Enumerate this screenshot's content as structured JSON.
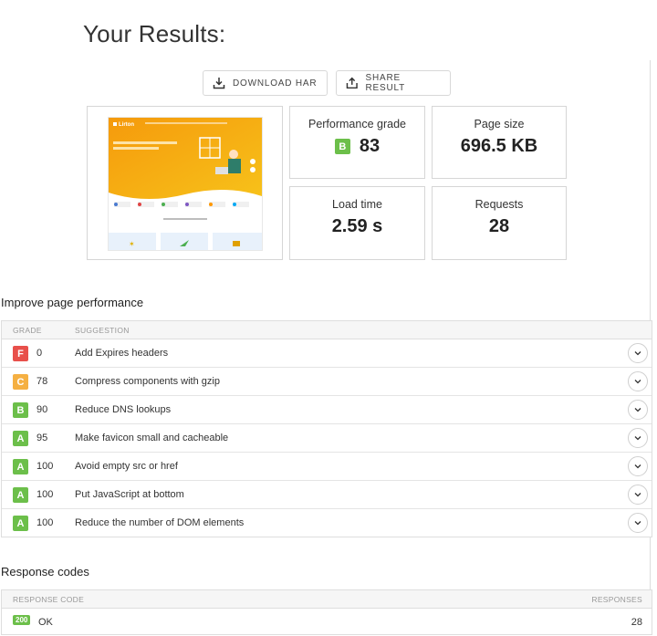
{
  "header": {
    "title": "Your Results:"
  },
  "actions": {
    "download_label": "DOWNLOAD HAR",
    "share_label": "SHARE RESULT"
  },
  "screenshot_thumb": {
    "brand": "Lirton",
    "hero_text": "Your Name - A Lean Blogging Ads Starter Learning"
  },
  "metrics": {
    "performance_label": "Performance grade",
    "performance_grade": "B",
    "performance_score": "83",
    "page_size_label": "Page size",
    "page_size_value": "696.5 KB",
    "load_time_label": "Load time",
    "load_time_value": "2.59 s",
    "requests_label": "Requests",
    "requests_value": "28"
  },
  "improve": {
    "title": "Improve page performance",
    "col_grade": "GRADE",
    "col_suggestion": "SUGGESTION",
    "rows": [
      {
        "grade": "F",
        "score": "0",
        "suggestion": "Add Expires headers"
      },
      {
        "grade": "C",
        "score": "78",
        "suggestion": "Compress components with gzip"
      },
      {
        "grade": "B",
        "score": "90",
        "suggestion": "Reduce DNS lookups"
      },
      {
        "grade": "A",
        "score": "95",
        "suggestion": "Make favicon small and cacheable"
      },
      {
        "grade": "A",
        "score": "100",
        "suggestion": "Avoid empty src or href"
      },
      {
        "grade": "A",
        "score": "100",
        "suggestion": "Put JavaScript at bottom"
      },
      {
        "grade": "A",
        "score": "100",
        "suggestion": "Reduce the number of DOM elements"
      }
    ]
  },
  "responses": {
    "title": "Response codes",
    "col_code": "RESPONSE CODE",
    "col_responses": "RESPONSES",
    "rows": [
      {
        "code": "200",
        "label": "OK",
        "count": "28"
      }
    ]
  },
  "colors": {
    "grade_A": "#6cbf4a",
    "grade_B": "#6cbf4a",
    "grade_C": "#f5b042",
    "grade_F": "#e8504b"
  }
}
